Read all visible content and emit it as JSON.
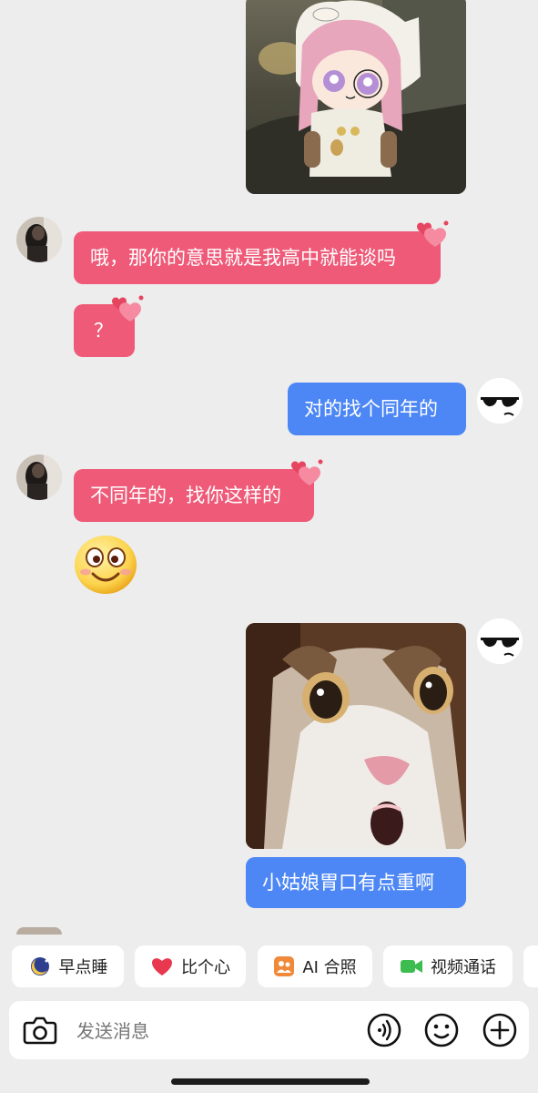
{
  "messages": [
    {
      "from": "self",
      "type": "image",
      "image": "anime-girl-sticker"
    },
    {
      "from": "other",
      "type": "text",
      "text": "哦，那你的意思就是我高中就能谈吗"
    },
    {
      "from": "other",
      "type": "text",
      "text": "？"
    },
    {
      "from": "self",
      "type": "text",
      "text": "对的找个同年的"
    },
    {
      "from": "other",
      "type": "text",
      "text": "不同年的，找你这样的"
    },
    {
      "from": "other",
      "type": "emoji",
      "image": "smiling-face-emoji"
    },
    {
      "from": "self",
      "type": "image",
      "image": "shocked-cat-photo"
    },
    {
      "from": "self",
      "type": "text",
      "text": "小姑娘胃口有点重啊"
    }
  ],
  "quick_actions": [
    {
      "label": "早点睡",
      "icon": "moon-icon"
    },
    {
      "label": "比个心",
      "icon": "heart-icon"
    },
    {
      "label": "AI 合照",
      "icon": "ai-photo-icon"
    },
    {
      "label": "视频通话",
      "icon": "video-call-icon"
    }
  ],
  "input": {
    "placeholder": "发送消息"
  },
  "colors": {
    "other_bubble": "#ee5a78",
    "self_bubble": "#4c87f5",
    "background": "#ededed"
  }
}
